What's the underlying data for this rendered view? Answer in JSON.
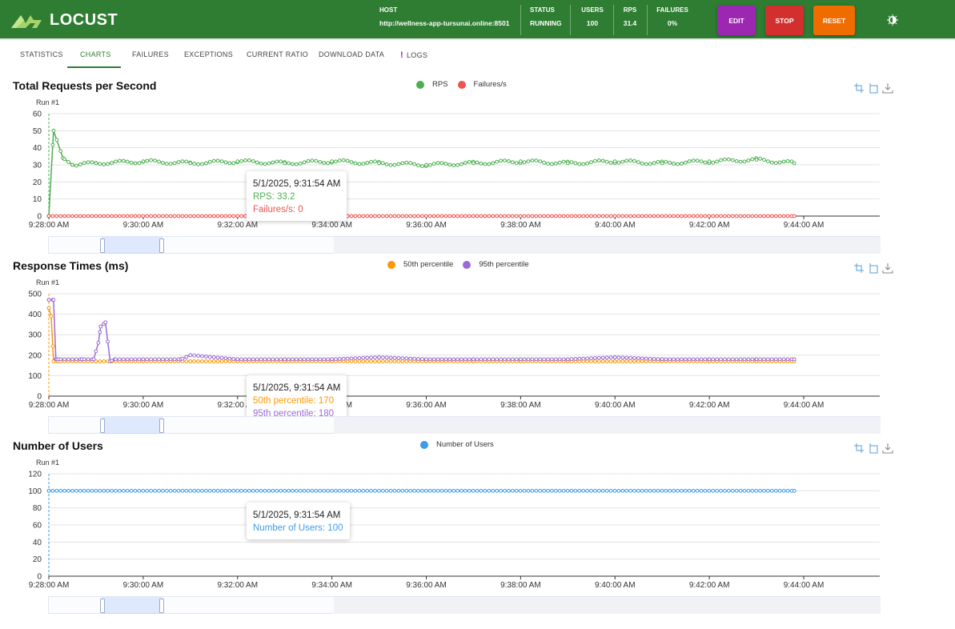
{
  "app": {
    "logo_text": "LOCUST",
    "host_label": "HOST",
    "host_value": "http://wellness-app-tursunai.online:8501",
    "status_label": "STATUS",
    "status_value": "RUNNING",
    "users_label": "USERS",
    "users_value": "100",
    "rps_label": "RPS",
    "rps_value": "31.4",
    "failures_label": "FAILURES",
    "failures_value": "0%",
    "buttons": {
      "edit": "EDIT",
      "stop": "STOP",
      "reset": "RESET"
    },
    "colors": {
      "header": "#2e7d32",
      "edit": "#9c27b0",
      "stop": "#d32f2f",
      "reset": "#ef6c00"
    }
  },
  "tabs": [
    {
      "label": "STATISTICS"
    },
    {
      "label": "CHARTS",
      "active": true
    },
    {
      "label": "FAILURES"
    },
    {
      "label": "EXCEPTIONS"
    },
    {
      "label": "CURRENT RATIO"
    },
    {
      "label": "DOWNLOAD DATA"
    },
    {
      "label": "LOGS",
      "badge": "!"
    }
  ],
  "charts": {
    "rps": {
      "title": "Total Requests per Second",
      "run": "Run #1",
      "legend": [
        {
          "name": "RPS",
          "color": "#4caf50"
        },
        {
          "name": "Failures/s",
          "color": "#ef5350"
        }
      ],
      "tooltip": {
        "time": "5/1/2025, 9:31:54 AM",
        "lines": [
          {
            "text": "RPS: 33.2",
            "color": "#4caf50"
          },
          {
            "text": "Failures/s: 0",
            "color": "#ef5350"
          }
        ]
      }
    },
    "response": {
      "title": "Response Times (ms)",
      "run": "Run #1",
      "legend": [
        {
          "name": "50th percentile",
          "color": "#ff9800"
        },
        {
          "name": "95th percentile",
          "color": "#9c6ad6"
        }
      ],
      "tooltip": {
        "time": "5/1/2025, 9:31:54 AM",
        "lines": [
          {
            "text": "50th percentile: 170",
            "color": "#ff9800"
          },
          {
            "text": "95th percentile: 180",
            "color": "#9c6ad6"
          }
        ]
      }
    },
    "users": {
      "title": "Number of Users",
      "run": "Run #1",
      "legend": [
        {
          "name": "Number of Users",
          "color": "#3d9be9"
        }
      ],
      "tooltip": {
        "time": "5/1/2025, 9:31:54 AM",
        "lines": [
          {
            "text": "Number of Users: 100",
            "color": "#3d9be9"
          }
        ]
      }
    }
  },
  "chart_data": [
    {
      "type": "line",
      "title": "Total Requests per Second",
      "x_ticks": [
        "9:28:00 AM",
        "9:30:00 AM",
        "9:32:00 AM",
        "9:34:00 AM",
        "9:36:00 AM",
        "9:38:00 AM",
        "9:40:00 AM",
        "9:42:00 AM",
        "9:44:00 AM"
      ],
      "y_ticks": [
        0,
        10,
        20,
        30,
        40,
        50,
        60
      ],
      "ylim": [
        0,
        60
      ],
      "x_range_minutes": [
        0,
        16
      ],
      "series": [
        {
          "name": "RPS",
          "x_minutes": [
            0,
            0.1,
            0.3,
            0.5,
            1,
            2,
            3,
            4,
            5,
            6,
            7,
            8,
            9,
            10,
            11,
            12,
            13,
            14,
            15,
            15.8
          ],
          "values": [
            0,
            50,
            34,
            30,
            31,
            32,
            31,
            32,
            31,
            32,
            31,
            30,
            31,
            32,
            31,
            32,
            31,
            32,
            33,
            31
          ]
        },
        {
          "name": "Failures/s",
          "x_minutes": [
            0,
            15.8
          ],
          "values": [
            0,
            0
          ]
        }
      ]
    },
    {
      "type": "line",
      "title": "Response Times (ms)",
      "x_ticks": [
        "9:28:00 AM",
        "9:30:00 AM",
        "9:32:00 AM",
        "9:34:00 AM",
        "9:36:00 AM",
        "9:38:00 AM",
        "9:40:00 AM",
        "9:42:00 AM",
        "9:44:00 AM"
      ],
      "y_ticks": [
        0,
        100,
        200,
        300,
        400,
        500
      ],
      "ylim": [
        0,
        500
      ],
      "x_range_minutes": [
        0,
        16
      ],
      "series": [
        {
          "name": "50th percentile",
          "x_minutes": [
            0,
            0.05,
            0.1,
            0.2,
            1,
            2,
            3,
            4,
            5,
            6,
            7,
            8,
            9,
            10,
            11,
            12,
            13,
            14,
            15,
            15.8
          ],
          "values": [
            430,
            390,
            170,
            170,
            170,
            170,
            170,
            170,
            170,
            170,
            170,
            170,
            170,
            170,
            170,
            170,
            170,
            170,
            170,
            170
          ]
        },
        {
          "name": "95th percentile",
          "x_minutes": [
            0,
            0.1,
            0.15,
            0.2,
            0.7,
            0.95,
            1.05,
            1.1,
            1.2,
            1.3,
            1.4,
            2,
            2.8,
            3,
            4,
            5,
            6,
            7,
            8,
            9,
            10,
            11,
            12,
            13,
            14,
            15,
            15.8
          ],
          "values": [
            470,
            470,
            180,
            180,
            180,
            180,
            260,
            340,
            360,
            170,
            180,
            180,
            180,
            200,
            180,
            180,
            180,
            190,
            180,
            180,
            180,
            180,
            190,
            180,
            180,
            180,
            180
          ]
        }
      ]
    },
    {
      "type": "line",
      "title": "Number of Users",
      "x_ticks": [
        "9:28:00 AM",
        "9:30:00 AM",
        "9:32:00 AM",
        "9:34:00 AM",
        "9:36:00 AM",
        "9:38:00 AM",
        "9:40:00 AM",
        "9:42:00 AM",
        "9:44:00 AM"
      ],
      "y_ticks": [
        0,
        20,
        40,
        60,
        80,
        100,
        120
      ],
      "ylim": [
        0,
        120
      ],
      "x_range_minutes": [
        0,
        16
      ],
      "series": [
        {
          "name": "Number of Users",
          "x_minutes": [
            0,
            15.8
          ],
          "values": [
            100,
            100
          ]
        }
      ]
    }
  ]
}
